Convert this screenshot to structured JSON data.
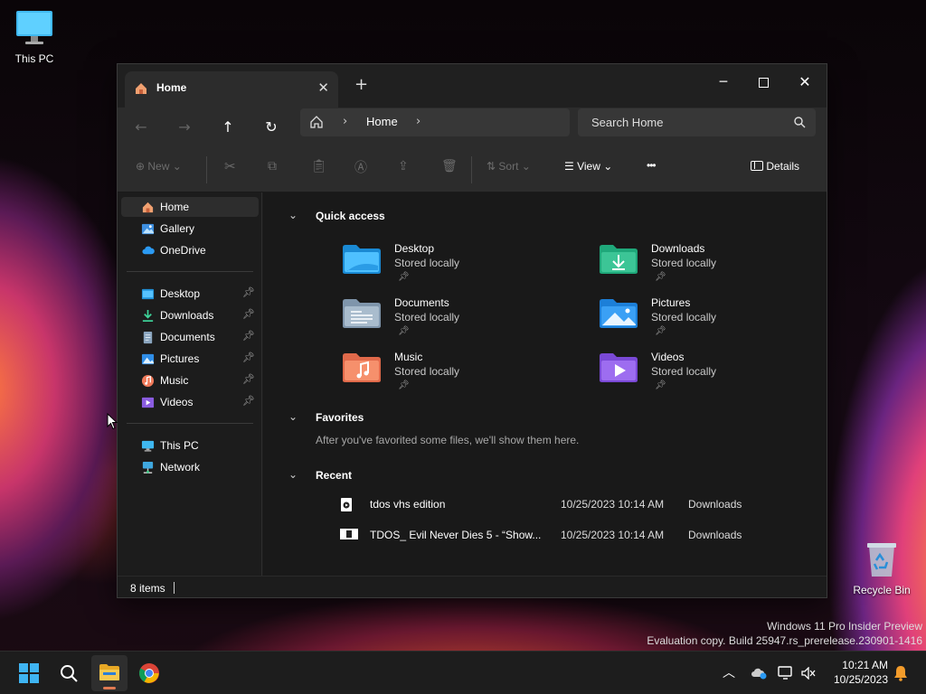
{
  "desktop": {
    "this_pc_label": "This PC",
    "recycle_bin_label": "Recycle Bin",
    "watermark_line1": "Windows 11 Pro Insider Preview",
    "watermark_line2": "Evaluation copy. Build 25947.rs_prerelease.230901-1416"
  },
  "window": {
    "tab_title": "Home",
    "new_tab_symbol": "+",
    "address": {
      "crumb": "Home"
    },
    "search": {
      "placeholder": "Search Home"
    },
    "commands": {
      "new": "New",
      "sort": "Sort",
      "view": "View",
      "more": "•••",
      "details": "Details"
    },
    "sidebar": {
      "top": [
        {
          "label": "Home",
          "icon": "home-icon"
        },
        {
          "label": "Gallery",
          "icon": "gallery-icon"
        },
        {
          "label": "OneDrive",
          "icon": "cloud-icon"
        }
      ],
      "pinned": [
        {
          "label": "Desktop",
          "icon": "desktop-folder-icon"
        },
        {
          "label": "Downloads",
          "icon": "download-icon"
        },
        {
          "label": "Documents",
          "icon": "document-icon"
        },
        {
          "label": "Pictures",
          "icon": "picture-icon"
        },
        {
          "label": "Music",
          "icon": "music-icon"
        },
        {
          "label": "Videos",
          "icon": "video-icon"
        }
      ],
      "devices": [
        {
          "label": "This PC",
          "icon": "computer-icon"
        },
        {
          "label": "Network",
          "icon": "network-icon"
        }
      ]
    },
    "sections": {
      "quick_access": "Quick access",
      "favorites": "Favorites",
      "favorites_empty": "After you've favorited some files, we'll show them here.",
      "recent": "Recent"
    },
    "quick_access": [
      {
        "name": "Desktop",
        "sub": "Stored locally"
      },
      {
        "name": "Downloads",
        "sub": "Stored locally"
      },
      {
        "name": "Documents",
        "sub": "Stored locally"
      },
      {
        "name": "Pictures",
        "sub": "Stored locally"
      },
      {
        "name": "Music",
        "sub": "Stored locally"
      },
      {
        "name": "Videos",
        "sub": "Stored locally"
      }
    ],
    "recent": [
      {
        "name": "tdos vhs edition",
        "date": "10/25/2023 10:14 AM",
        "location": "Downloads"
      },
      {
        "name": "TDOS_ Evil Never Dies 5 - “Show...",
        "date": "10/25/2023 10:14 AM",
        "location": "Downloads"
      }
    ],
    "status": {
      "count": "8 items"
    }
  },
  "taskbar": {
    "time": "10:21 AM",
    "date": "10/25/2023"
  },
  "colors": {
    "accent": "#4cc2ff",
    "folder_yellow": "#f2c14e",
    "window_bg": "#1c1c1c"
  }
}
